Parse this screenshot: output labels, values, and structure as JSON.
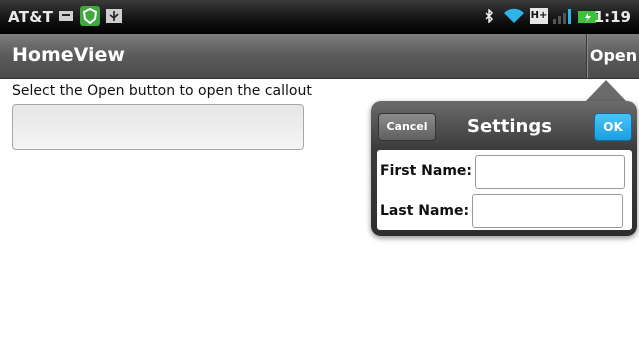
{
  "status_bar": {
    "carrier": "AT&T",
    "left_icons": [
      "notification-icon",
      "shield-icon",
      "usb-icon"
    ],
    "right_icons": [
      "bluetooth-icon",
      "wifi-icon",
      "hplus-network-icon",
      "signal-icon",
      "battery-icon"
    ],
    "network_label": "H+",
    "time": "1:19"
  },
  "header": {
    "title": "HomeView",
    "open_label": "Open"
  },
  "main": {
    "instructions": "Select the Open button to open the callout",
    "input_value": ""
  },
  "callout": {
    "title": "Settings",
    "cancel_label": "Cancel",
    "ok_label": "OK",
    "first_name_label": "First Name:",
    "first_name_value": "",
    "last_name_label": "Last Name:",
    "last_name_value": ""
  },
  "colors": {
    "ok_button": "#1b9fe0",
    "header": "#5a5a5a",
    "status_bar": "#000000"
  }
}
